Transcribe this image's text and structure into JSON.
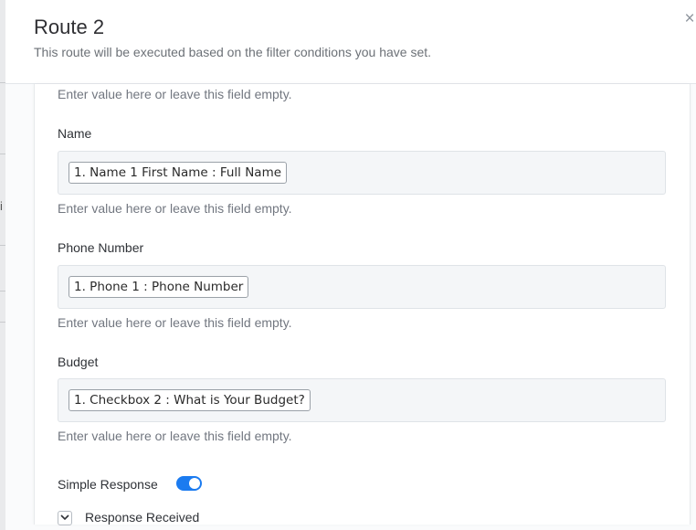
{
  "modal": {
    "title": "Route 2",
    "subtitle": "This route will be executed based on the filter conditions you have set.",
    "close_glyph": "×"
  },
  "background": {
    "glyph": "i"
  },
  "fields": [
    {
      "label": "",
      "value": "",
      "hint": "Enter value here or leave this field empty."
    },
    {
      "label": "Name",
      "value": "1. Name 1 First Name : Full Name",
      "hint": "Enter value here or leave this field empty."
    },
    {
      "label": "Phone Number",
      "value": "1. Phone 1 : Phone Number",
      "hint": "Enter value here or leave this field empty."
    },
    {
      "label": "Budget",
      "value": "1. Checkbox 2 : What is Your Budget?",
      "hint": "Enter value here or leave this field empty."
    }
  ],
  "simple_response": {
    "label": "Simple Response",
    "enabled": true
  },
  "response_received": {
    "label": "Response Received",
    "expanded": true
  },
  "colors": {
    "accent": "#1b7bf0",
    "field_bg": "#f4f6f8"
  }
}
